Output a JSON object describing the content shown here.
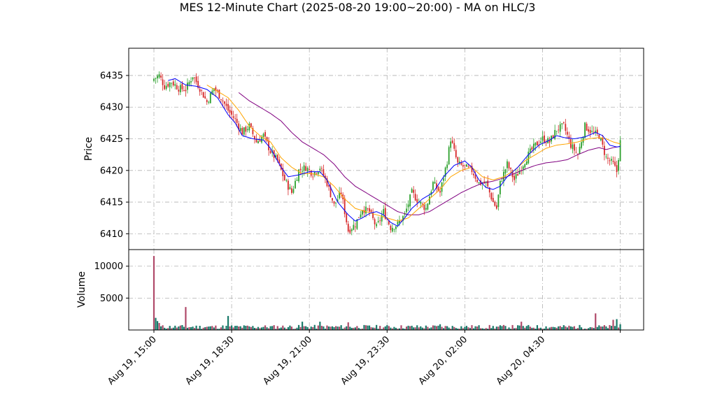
{
  "chart_data": {
    "type": "candlestick",
    "title": "MES 12-Minute Chart (2025-08-20 19:00~20:00) - MA on HLC/3",
    "price_panel": {
      "ylabel": "Price",
      "ylim": [
        6407.5,
        6439.3
      ],
      "yticks": [
        6410,
        6415,
        6420,
        6425,
        6430,
        6435
      ]
    },
    "volume_panel": {
      "ylabel": "Volume",
      "ylim": [
        0,
        12600
      ],
      "yticks": [
        5000,
        10000
      ]
    },
    "x_axis": {
      "tick_labels": [
        "Aug 19, 15:00",
        "Aug 19, 18:30",
        "Aug 19, 21:00",
        "Aug 19, 23:30",
        "Aug 20, 02:00",
        "Aug 20, 04:30"
      ],
      "grid": true
    },
    "colors": {
      "up": "#2ca02c",
      "down": "#d62728",
      "volume_up": "#1a7a6a",
      "volume_down": "#b04a6a",
      "ma_short": "#0000ff",
      "ma_mid": "#ffa500",
      "ma_long": "#800080",
      "grid": "#b0b0b0"
    },
    "close_anchors": [
      [
        0,
        6434.5
      ],
      [
        3,
        6435.0
      ],
      [
        6,
        6433.3
      ],
      [
        10,
        6434.0
      ],
      [
        14,
        6433.0
      ],
      [
        18,
        6432.8
      ],
      [
        22,
        6435.0
      ],
      [
        26,
        6433.0
      ],
      [
        30,
        6430.8
      ],
      [
        34,
        6433.0
      ],
      [
        38,
        6431.5
      ],
      [
        42,
        6429.5
      ],
      [
        46,
        6428.0
      ],
      [
        50,
        6426.0
      ],
      [
        54,
        6427.0
      ],
      [
        58,
        6424.5
      ],
      [
        62,
        6425.5
      ],
      [
        66,
        6423.0
      ],
      [
        70,
        6421.5
      ],
      [
        74,
        6418.5
      ],
      [
        78,
        6416.5
      ],
      [
        82,
        6420.0
      ],
      [
        86,
        6420.5
      ],
      [
        90,
        6419.5
      ],
      [
        94,
        6420.5
      ],
      [
        98,
        6418.0
      ],
      [
        102,
        6414.5
      ],
      [
        106,
        6416.5
      ],
      [
        110,
        6410.5
      ],
      [
        114,
        6411.5
      ],
      [
        118,
        6414.0
      ],
      [
        122,
        6413.5
      ],
      [
        126,
        6411.0
      ],
      [
        130,
        6413.5
      ],
      [
        134,
        6411.0
      ],
      [
        138,
        6411.5
      ],
      [
        142,
        6413.0
      ],
      [
        146,
        6416.5
      ],
      [
        150,
        6415.0
      ],
      [
        154,
        6414.0
      ],
      [
        158,
        6418.0
      ],
      [
        162,
        6416.5
      ],
      [
        166,
        6421.5
      ],
      [
        168,
        6425.0
      ],
      [
        172,
        6421.0
      ],
      [
        176,
        6420.5
      ],
      [
        180,
        6420.0
      ],
      [
        184,
        6418.0
      ],
      [
        188,
        6418.0
      ],
      [
        192,
        6415.0
      ],
      [
        194,
        6414.0
      ],
      [
        196,
        6418.0
      ],
      [
        200,
        6421.0
      ],
      [
        204,
        6418.5
      ],
      [
        208,
        6420.5
      ],
      [
        212,
        6422.5
      ],
      [
        216,
        6424.0
      ],
      [
        220,
        6425.0
      ],
      [
        224,
        6424.5
      ],
      [
        228,
        6426.5
      ],
      [
        232,
        6427.0
      ],
      [
        236,
        6424.0
      ],
      [
        240,
        6422.5
      ],
      [
        244,
        6427.0
      ],
      [
        248,
        6426.0
      ],
      [
        252,
        6425.5
      ],
      [
        256,
        6422.0
      ],
      [
        260,
        6421.0
      ],
      [
        262,
        6419.8
      ],
      [
        264,
        6424.5
      ]
    ],
    "ma_short_anchors": [
      [
        8,
        6434.2
      ],
      [
        12,
        6434.5
      ],
      [
        18,
        6433.5
      ],
      [
        24,
        6433.3
      ],
      [
        30,
        6432.8
      ],
      [
        36,
        6431.5
      ],
      [
        42,
        6428.8
      ],
      [
        46,
        6427.5
      ],
      [
        50,
        6425.5
      ],
      [
        56,
        6425.0
      ],
      [
        62,
        6424.8
      ],
      [
        66,
        6423.5
      ],
      [
        72,
        6420.5
      ],
      [
        76,
        6419.0
      ],
      [
        82,
        6419.3
      ],
      [
        88,
        6419.8
      ],
      [
        94,
        6419.8
      ],
      [
        98,
        6418.5
      ],
      [
        104,
        6415.0
      ],
      [
        110,
        6413.0
      ],
      [
        114,
        6412.0
      ],
      [
        118,
        6412.5
      ],
      [
        122,
        6413.2
      ],
      [
        126,
        6413.5
      ],
      [
        130,
        6413.0
      ],
      [
        134,
        6411.8
      ],
      [
        138,
        6411.2
      ],
      [
        142,
        6412.5
      ],
      [
        146,
        6414.0
      ],
      [
        152,
        6415.5
      ],
      [
        158,
        6416.5
      ],
      [
        164,
        6419.0
      ],
      [
        170,
        6420.8
      ],
      [
        176,
        6421.5
      ],
      [
        180,
        6420.5
      ],
      [
        184,
        6418.5
      ],
      [
        188,
        6417.3
      ],
      [
        192,
        6417.0
      ],
      [
        196,
        6417.5
      ],
      [
        200,
        6419.0
      ],
      [
        206,
        6420.5
      ],
      [
        212,
        6422.5
      ],
      [
        218,
        6424.0
      ],
      [
        224,
        6424.8
      ],
      [
        228,
        6425.5
      ],
      [
        232,
        6425.2
      ],
      [
        238,
        6425.0
      ],
      [
        244,
        6425.3
      ],
      [
        250,
        6426.0
      ],
      [
        254,
        6425.5
      ],
      [
        258,
        6424.0
      ],
      [
        262,
        6423.7
      ],
      [
        264,
        6423.8
      ]
    ],
    "ma_mid_anchors": [
      [
        30,
        6433.5
      ],
      [
        36,
        6432.5
      ],
      [
        42,
        6431.5
      ],
      [
        48,
        6429.5
      ],
      [
        54,
        6427.0
      ],
      [
        60,
        6425.5
      ],
      [
        66,
        6424.5
      ],
      [
        72,
        6422.0
      ],
      [
        78,
        6420.5
      ],
      [
        84,
        6419.5
      ],
      [
        90,
        6419.5
      ],
      [
        96,
        6419.0
      ],
      [
        102,
        6417.5
      ],
      [
        108,
        6415.5
      ],
      [
        114,
        6414.0
      ],
      [
        120,
        6413.5
      ],
      [
        126,
        6413.0
      ],
      [
        132,
        6412.5
      ],
      [
        138,
        6412.0
      ],
      [
        144,
        6412.5
      ],
      [
        150,
        6414.0
      ],
      [
        156,
        6415.5
      ],
      [
        162,
        6417.0
      ],
      [
        168,
        6419.0
      ],
      [
        174,
        6420.0
      ],
      [
        180,
        6420.5
      ],
      [
        186,
        6419.0
      ],
      [
        192,
        6418.5
      ],
      [
        198,
        6419.0
      ],
      [
        204,
        6420.0
      ],
      [
        210,
        6421.5
      ],
      [
        216,
        6422.5
      ],
      [
        222,
        6423.5
      ],
      [
        228,
        6424.0
      ],
      [
        234,
        6424.2
      ],
      [
        240,
        6424.5
      ],
      [
        246,
        6425.0
      ],
      [
        252,
        6425.2
      ],
      [
        256,
        6425.0
      ],
      [
        260,
        6424.5
      ],
      [
        264,
        6424.2
      ]
    ],
    "ma_long_anchors": [
      [
        48,
        6432.3
      ],
      [
        54,
        6431.0
      ],
      [
        60,
        6430.0
      ],
      [
        66,
        6429.0
      ],
      [
        72,
        6427.8
      ],
      [
        78,
        6426.0
      ],
      [
        84,
        6424.5
      ],
      [
        90,
        6423.5
      ],
      [
        96,
        6422.5
      ],
      [
        102,
        6421.0
      ],
      [
        108,
        6419.0
      ],
      [
        114,
        6417.5
      ],
      [
        120,
        6416.5
      ],
      [
        126,
        6415.5
      ],
      [
        132,
        6414.5
      ],
      [
        138,
        6413.5
      ],
      [
        144,
        6413.0
      ],
      [
        150,
        6413.0
      ],
      [
        156,
        6413.5
      ],
      [
        162,
        6414.5
      ],
      [
        168,
        6415.5
      ],
      [
        174,
        6416.5
      ],
      [
        180,
        6417.3
      ],
      [
        186,
        6418.0
      ],
      [
        192,
        6418.3
      ],
      [
        198,
        6418.8
      ],
      [
        204,
        6419.5
      ],
      [
        210,
        6420.2
      ],
      [
        216,
        6420.8
      ],
      [
        222,
        6421.2
      ],
      [
        228,
        6421.4
      ],
      [
        234,
        6421.7
      ],
      [
        240,
        6422.5
      ],
      [
        246,
        6423.2
      ],
      [
        252,
        6423.6
      ],
      [
        256,
        6423.3
      ],
      [
        260,
        6423.6
      ],
      [
        264,
        6423.8
      ]
    ],
    "volume_spikes": [
      [
        0,
        11600
      ],
      [
        1,
        1900
      ],
      [
        2,
        1400
      ],
      [
        3,
        1100
      ],
      [
        18,
        3600
      ],
      [
        42,
        2200
      ],
      [
        84,
        1300
      ],
      [
        94,
        1300
      ],
      [
        110,
        1200
      ],
      [
        162,
        900
      ],
      [
        208,
        1300
      ],
      [
        250,
        2600
      ],
      [
        260,
        1600
      ],
      [
        262,
        1700
      ],
      [
        264,
        900
      ]
    ]
  }
}
